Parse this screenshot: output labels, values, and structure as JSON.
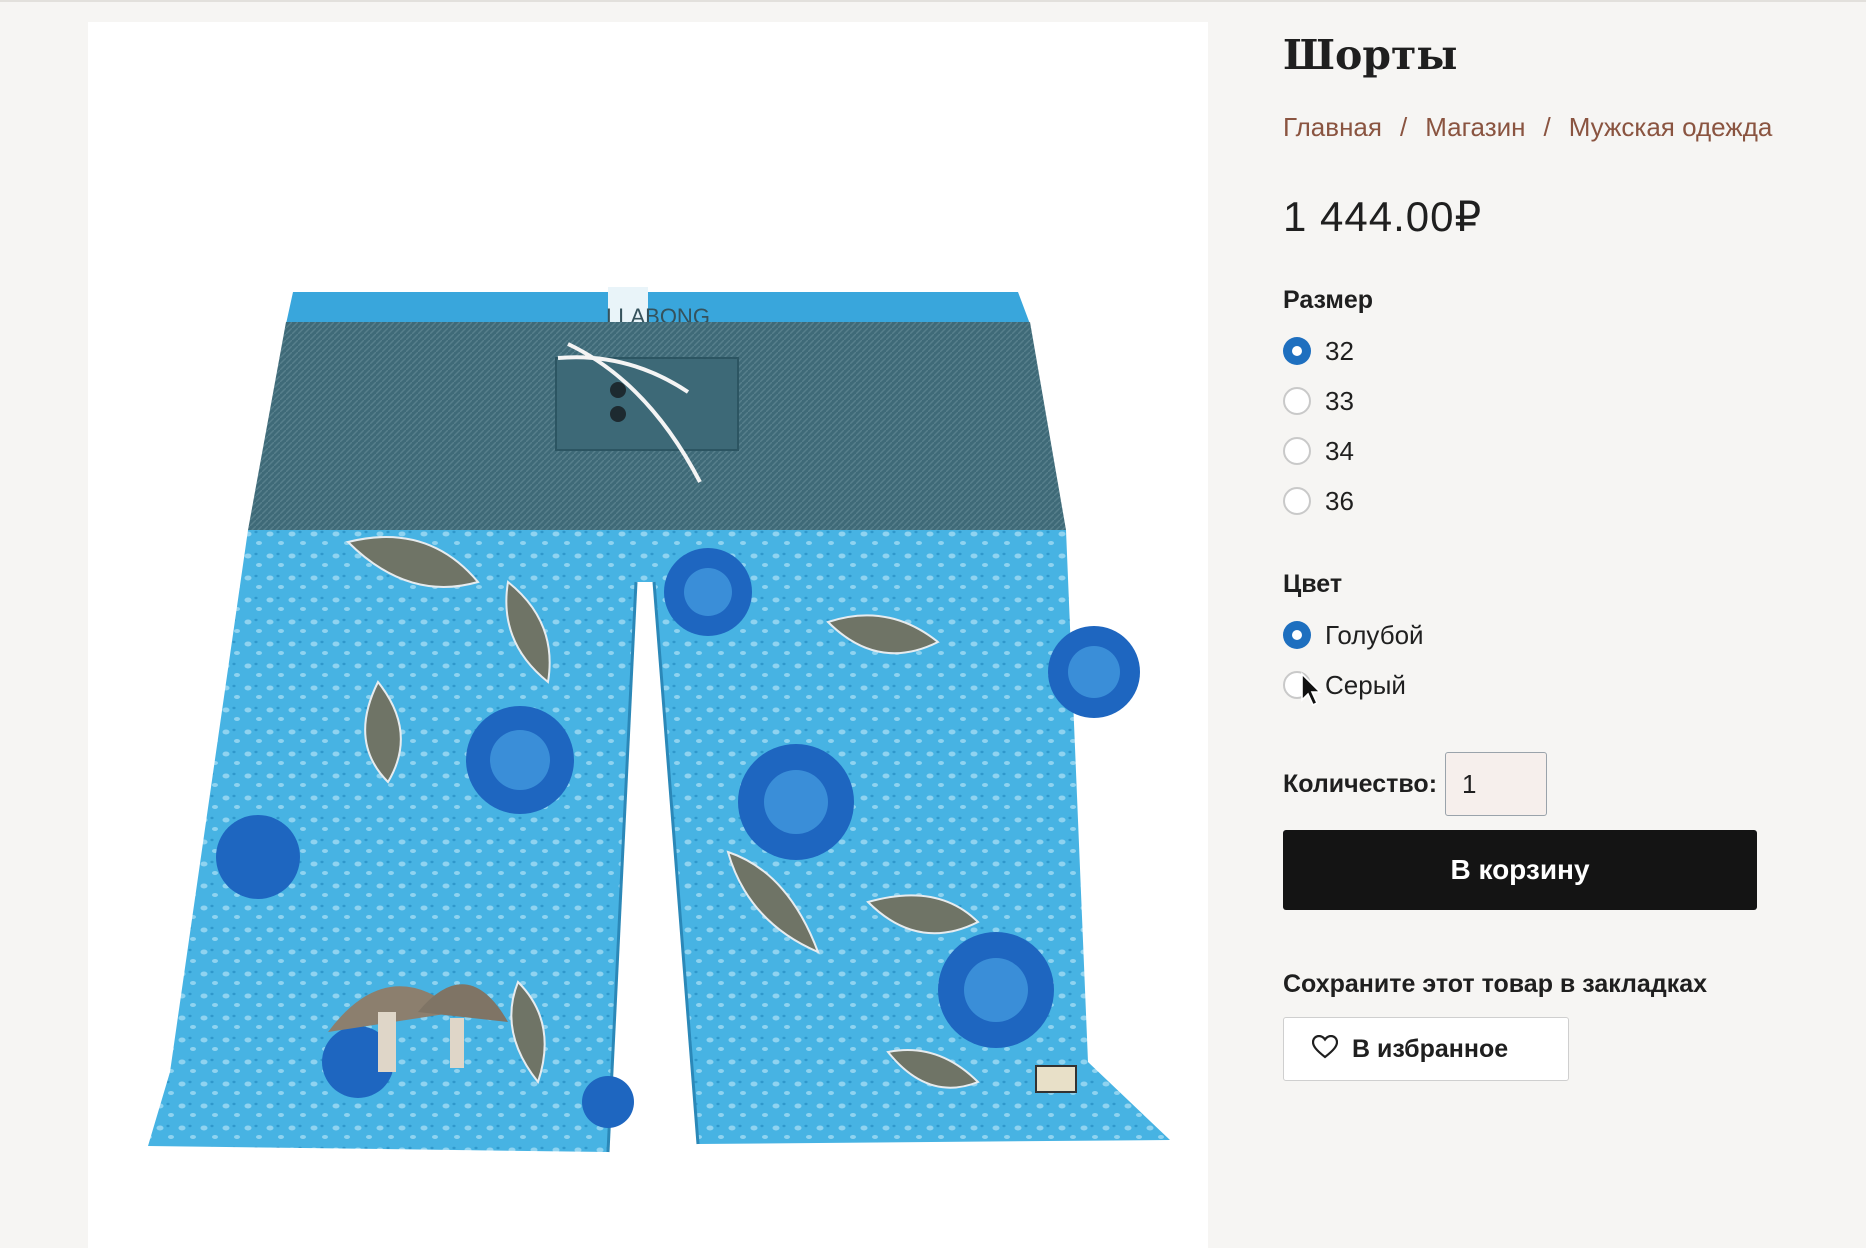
{
  "product": {
    "title": "Шорты",
    "image_alt": "Шорты",
    "image_brand_text": "LLABONG",
    "price": "1 444.00₽"
  },
  "breadcrumb": {
    "items": [
      "Главная",
      "Магазин",
      "Мужская одежда"
    ],
    "separator": "/"
  },
  "size": {
    "label": "Размер",
    "options": [
      "32",
      "33",
      "34",
      "36"
    ],
    "selected": "32"
  },
  "color": {
    "label": "Цвет",
    "options": [
      "Голубой",
      "Серый"
    ],
    "selected": "Голубой"
  },
  "quantity": {
    "label": "Количество:",
    "value": "1"
  },
  "cart": {
    "label": "В корзину"
  },
  "bookmark": {
    "heading": "Сохраните этот товар в закладках",
    "favorite_label": "В избранное"
  },
  "colors": {
    "accent": "#1e6fbf",
    "link": "#8a5440",
    "button_bg": "#141414"
  }
}
